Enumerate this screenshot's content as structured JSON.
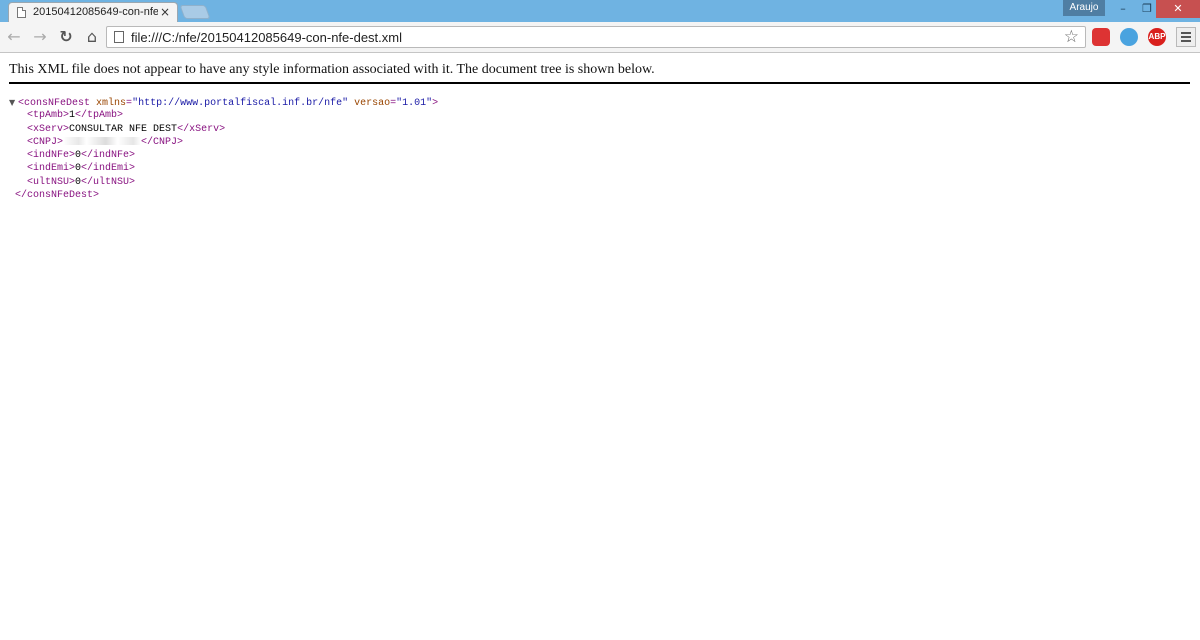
{
  "browser": {
    "tab_title": "20150412085649-con-nfe",
    "tab_close": "×",
    "profile_name": "Araujo",
    "window_buttons": {
      "minimize": "–",
      "maximize": "❐",
      "close": "✕"
    },
    "nav": {
      "back": "←",
      "forward": "→",
      "reload": "↻",
      "home": "⌂"
    },
    "url": "file:///C:/nfe/20150412085649-con-nfe-dest.xml",
    "star": "☆",
    "extensions": {
      "ext1": "",
      "ext2": "",
      "adblock": "ABP"
    }
  },
  "page": {
    "notice": "This XML file does not appear to have any style information associated with it. The document tree is shown below.",
    "xml": {
      "root_open": "<consNFeDest",
      "xmlns_name": "xmlns",
      "xmlns_value": "\"http://www.portalfiscal.inf.br/nfe\"",
      "versao_name": "versao",
      "versao_value": "\"1.01\"",
      "gt": ">",
      "tpAmb": {
        "open": "<tpAmb>",
        "value": "1",
        "close": "</tpAmb>"
      },
      "xServ": {
        "open": "<xServ>",
        "value": "CONSULTAR NFE DEST",
        "close": "</xServ>"
      },
      "CNPJ": {
        "open": "<CNPJ>",
        "close": "</CNPJ>"
      },
      "indNFe": {
        "open": "<indNFe>",
        "value": "0",
        "close": "</indNFe>"
      },
      "indEmi": {
        "open": "<indEmi>",
        "value": "0",
        "close": "</indEmi>"
      },
      "ultNSU": {
        "open": "<ultNSU>",
        "value": "0",
        "close": "</ultNSU>"
      },
      "root_close": "</consNFeDest>",
      "expander": "▼"
    }
  },
  "colors": {
    "tabstrip": "#6fb3e2",
    "tag": "#881280",
    "attr_name": "#994500",
    "attr_value": "#1a1aa6"
  }
}
